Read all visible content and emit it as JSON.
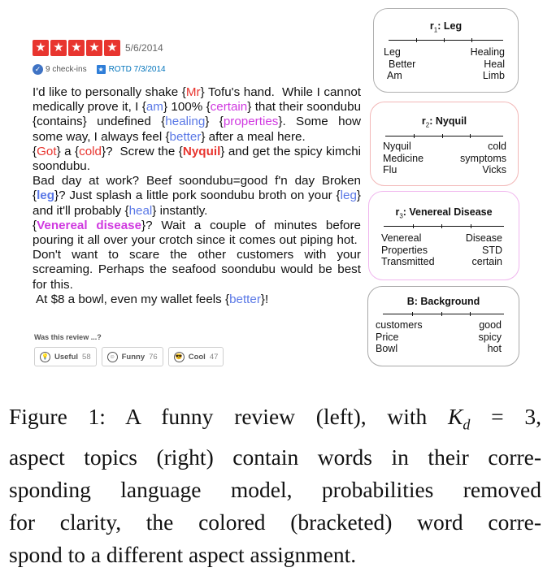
{
  "review": {
    "rating_stars": 5,
    "date": "5/6/2014",
    "checkins": "9 check-ins",
    "rotd": "ROTD 7/3/2014",
    "question": "Was this review ...?",
    "votes": [
      {
        "label": "Useful",
        "count": "58"
      },
      {
        "label": "Funny",
        "count": "76"
      },
      {
        "label": "Cool",
        "count": "47"
      }
    ]
  },
  "topics": [
    {
      "title_prefix": "r",
      "title_sub": "1",
      "title_name": ": Leg",
      "left": [
        "Leg",
        "Better",
        "Am"
      ],
      "right": [
        "Healing",
        "Heal",
        "Limb"
      ]
    },
    {
      "title_prefix": "r",
      "title_sub": "2",
      "title_name": ": Nyquil",
      "left": [
        "Nyquil",
        "Medicine",
        "Flu"
      ],
      "right": [
        "cold",
        "symptoms",
        "Vicks"
      ]
    },
    {
      "title_prefix": "r",
      "title_sub": "3",
      "title_name": ": Venereal Disease",
      "left": [
        "Venereal",
        "Properties",
        "Transmitted"
      ],
      "right": [
        "Disease",
        "STD",
        "certain"
      ]
    },
    {
      "title_prefix": "",
      "title_sub": "",
      "title_name": "B: Background",
      "left": [
        "customers",
        "Price",
        "Bowl"
      ],
      "right": [
        "good",
        "spicy",
        "hot"
      ]
    }
  ],
  "box_colors": {
    "r1": "#b0b0b0",
    "r2": "#f2b8b8",
    "r3": "#f0b6ee",
    "b": "#a8a8a8"
  },
  "word_colors": {
    "red": "#e8352f",
    "purple": "#d03ae0",
    "blue": "#5a78e6"
  },
  "caption": {
    "line1_a": "Figure 1:  A funny review (left), with",
    "line1_k": "K",
    "line1_sub": "d",
    "line1_b": "= 3,",
    "line2": "aspect topics (right) contain words in their corre-",
    "line3": "sponding language model, probabilities removed",
    "line4": "for clarity, the colored (bracketed) word corre-",
    "line5": "spond to a different aspect assignment."
  }
}
